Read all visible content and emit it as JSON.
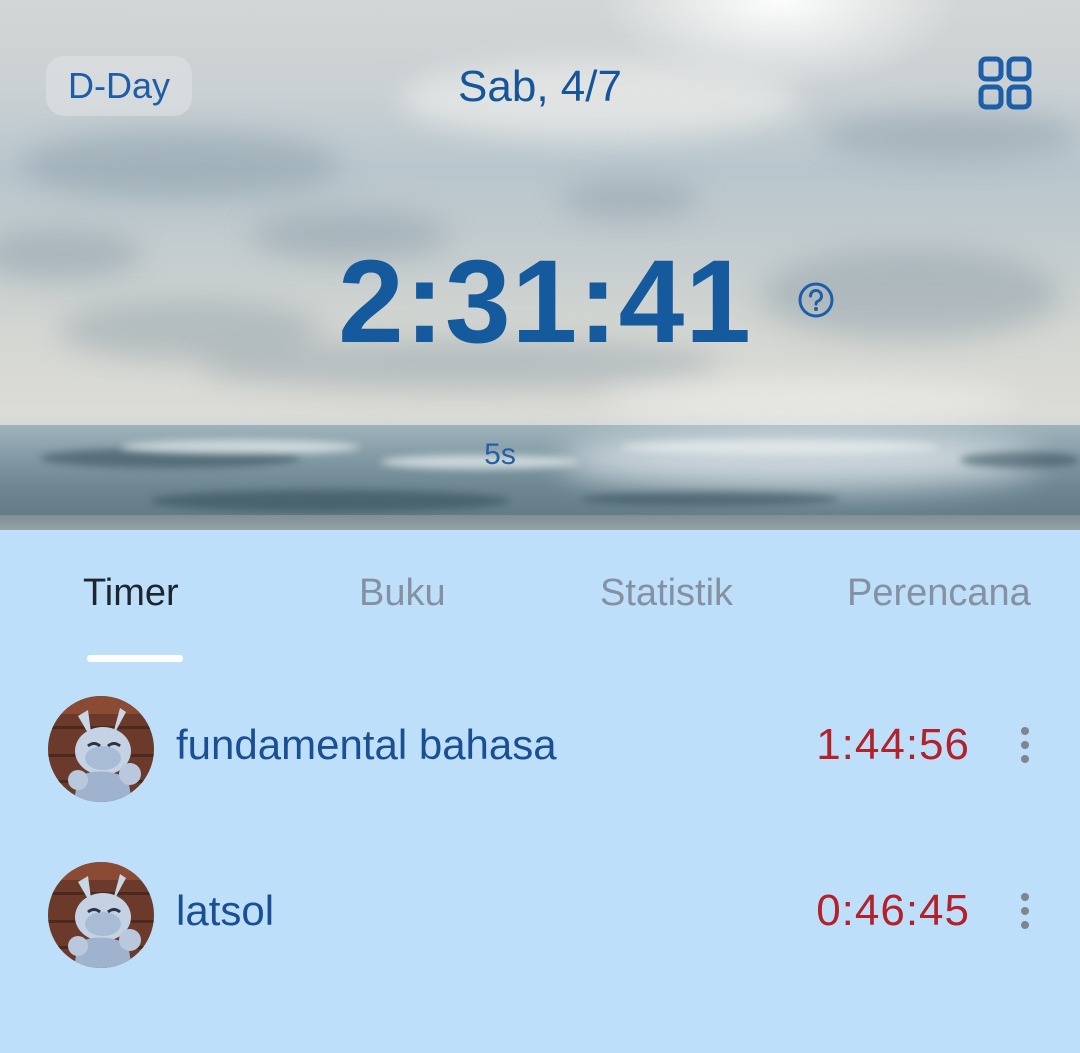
{
  "header": {
    "dday_label": "D-Day",
    "date": "Sab, 4/7",
    "grid_icon": "grid-icon"
  },
  "timer": {
    "main_time": "2:31:41",
    "help_icon": "help-circle-icon",
    "interval": "5s"
  },
  "tabs": [
    {
      "label": "Timer",
      "active": true
    },
    {
      "label": "Buku",
      "active": false
    },
    {
      "label": "Statistik",
      "active": false
    },
    {
      "label": "Perencana",
      "active": false
    }
  ],
  "subjects": [
    {
      "name": "fundamental bahasa",
      "time": "1:44:56",
      "menu_icon": "more-vertical-icon"
    },
    {
      "name": "latsol",
      "time": "0:46:45",
      "menu_icon": "more-vertical-icon"
    }
  ],
  "colors": {
    "accent": "#145a9d",
    "subject_time": "#b3212b",
    "panel_bg": "#bedffa",
    "tab_indicator": "#ffffff"
  }
}
